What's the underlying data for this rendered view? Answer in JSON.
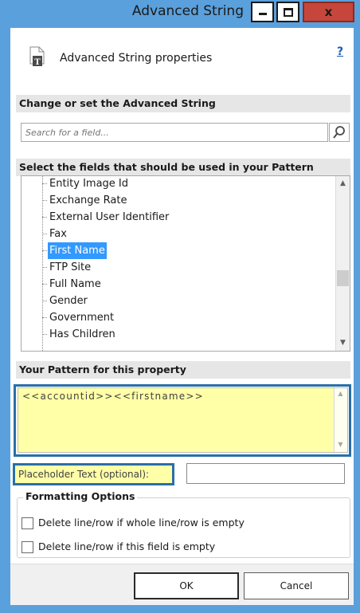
{
  "window": {
    "title": "Advanced String",
    "close_label": "x"
  },
  "header": {
    "title": "Advanced String properties",
    "help": "?",
    "icon": "document-T-icon"
  },
  "sections": {
    "change": "Change or set the Advanced String",
    "select": "Select the fields that should be used in your Pattern",
    "pattern": "Your Pattern for this property"
  },
  "search": {
    "placeholder": "Search for a field..."
  },
  "fields": [
    "Entity Image Id",
    "Exchange Rate",
    "External User Identifier",
    "Fax",
    "First Name",
    "FTP Site",
    "Full Name",
    "Gender",
    "Government",
    "Has Children"
  ],
  "selected_field": "First Name",
  "pattern": {
    "value": "<<accountid>><<firstname>>"
  },
  "placeholder": {
    "label": "Placeholder Text (optional):",
    "value": ""
  },
  "formatting": {
    "title": "Formatting Options",
    "options": [
      {
        "label": "Delete line/row if whole line/row is empty",
        "checked": false
      },
      {
        "label": "Delete line/row if this field is empty",
        "checked": false
      }
    ]
  },
  "buttons": {
    "ok": "OK",
    "cancel": "Cancel"
  },
  "colors": {
    "titlebar": "#5aa0dc",
    "highlight": "#ffffa8",
    "selection": "#3399ff",
    "callout": "#2a6fa8"
  }
}
